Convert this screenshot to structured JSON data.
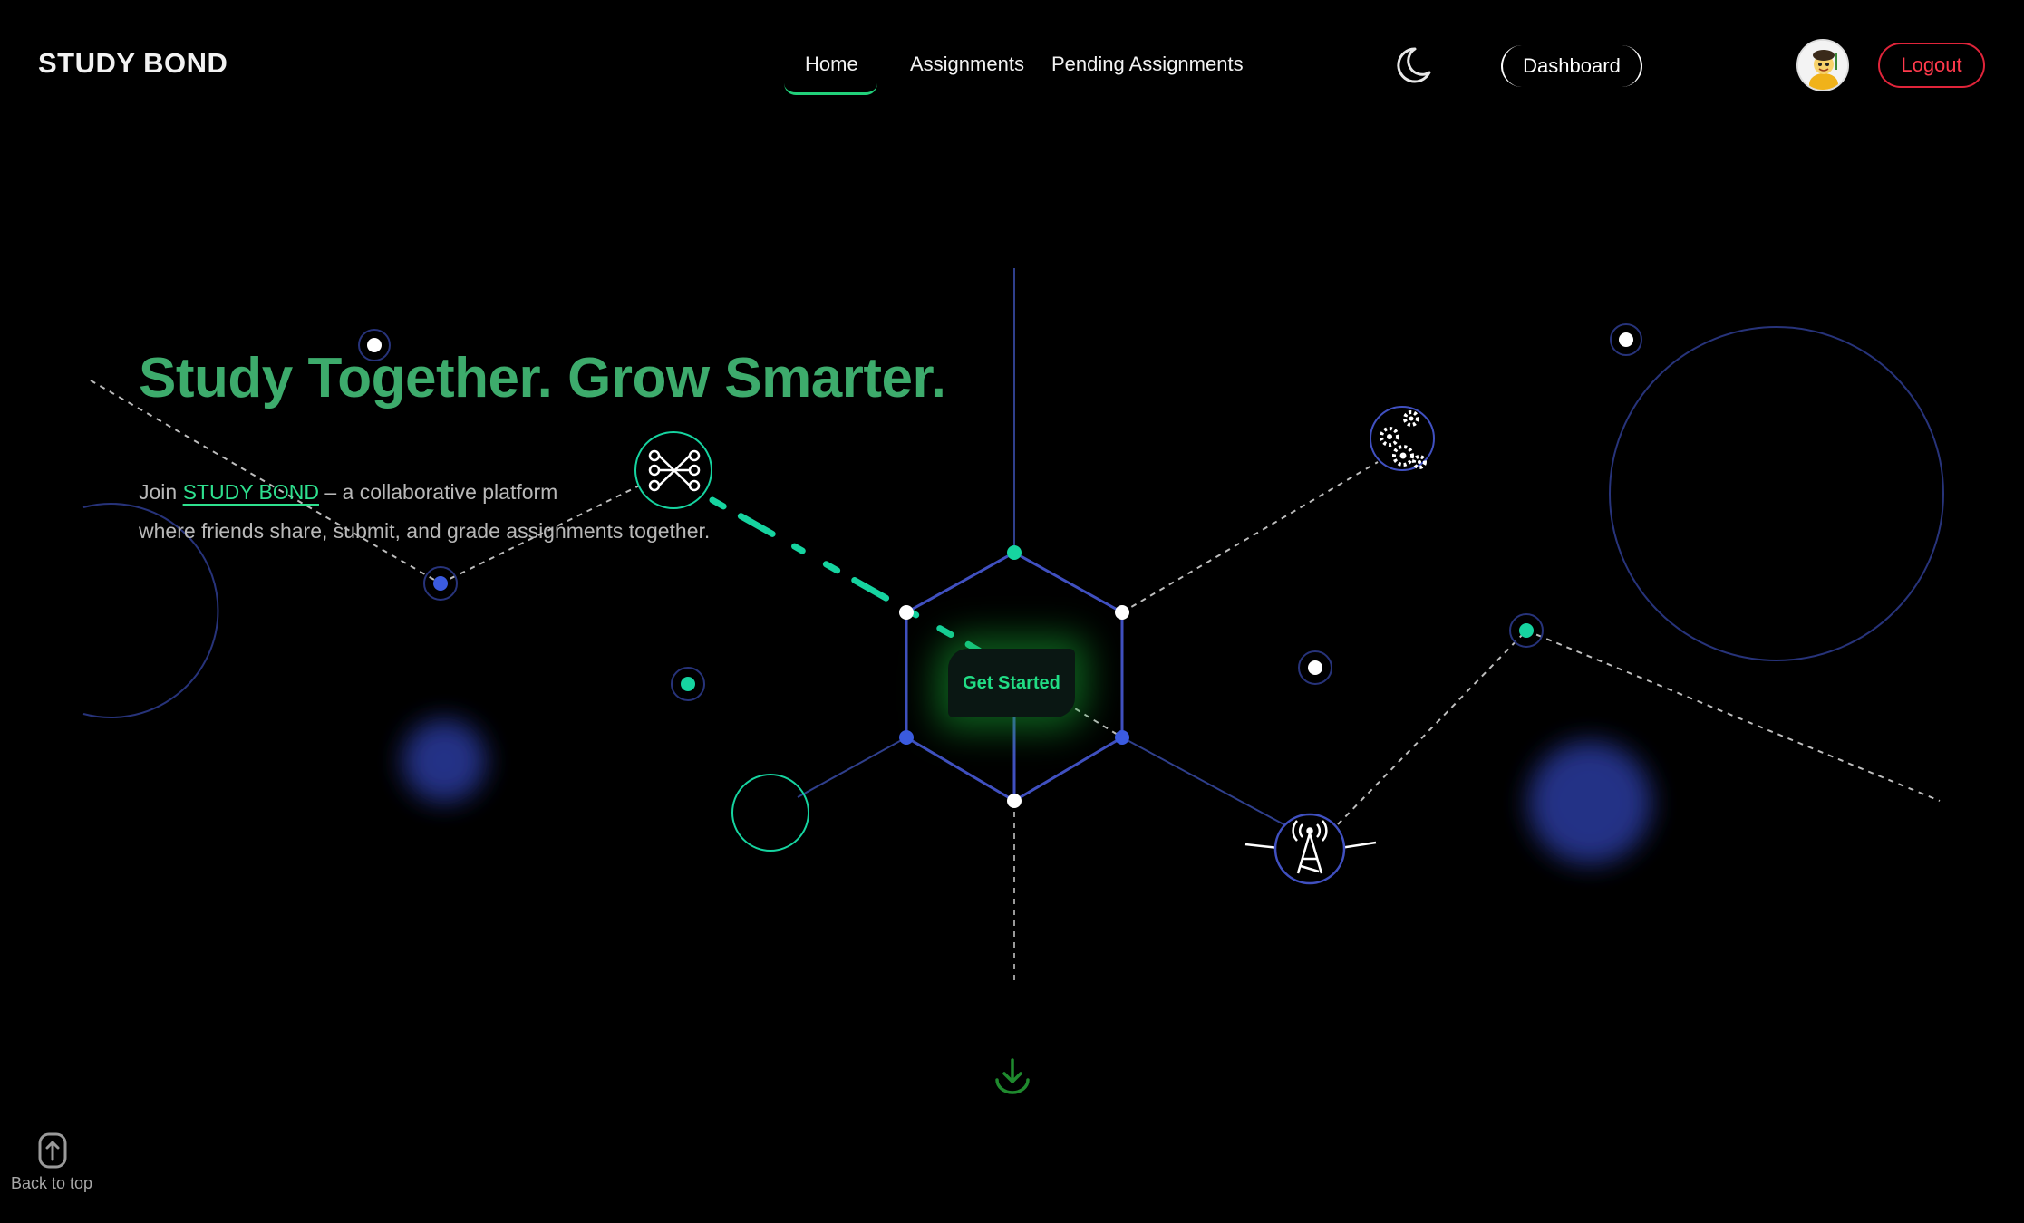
{
  "nav": {
    "brand": "STUDY BOND",
    "links": [
      {
        "label": "Home",
        "active": true
      },
      {
        "label": "Assignments"
      },
      {
        "label": "Pending Assignments"
      }
    ],
    "dashboard_label": "Dashboard",
    "logout_label": "Logout",
    "theme_icon": "moon-icon",
    "avatar_icon": "user-avatar"
  },
  "hero": {
    "title": "Study Together. Grow Smarter.",
    "desc_prefix": "Join ",
    "desc_brand": "STUDY BOND",
    "desc_suffix": " – a collaborative platform",
    "desc_line2": "where friends share, submit, and grade assignments together.",
    "cta_label": "Get Started"
  },
  "footer": {
    "back_to_top_label": "Back to top",
    "scroll_icon": "arrow-down-icon",
    "back_icon": "arrow-up-icon"
  },
  "colors": {
    "accent_green": "#21d07a",
    "title_green": "#3dab6c",
    "logout_red": "#e0243a",
    "network_blue": "#3b52b8",
    "node_teal": "#16d4a0"
  }
}
